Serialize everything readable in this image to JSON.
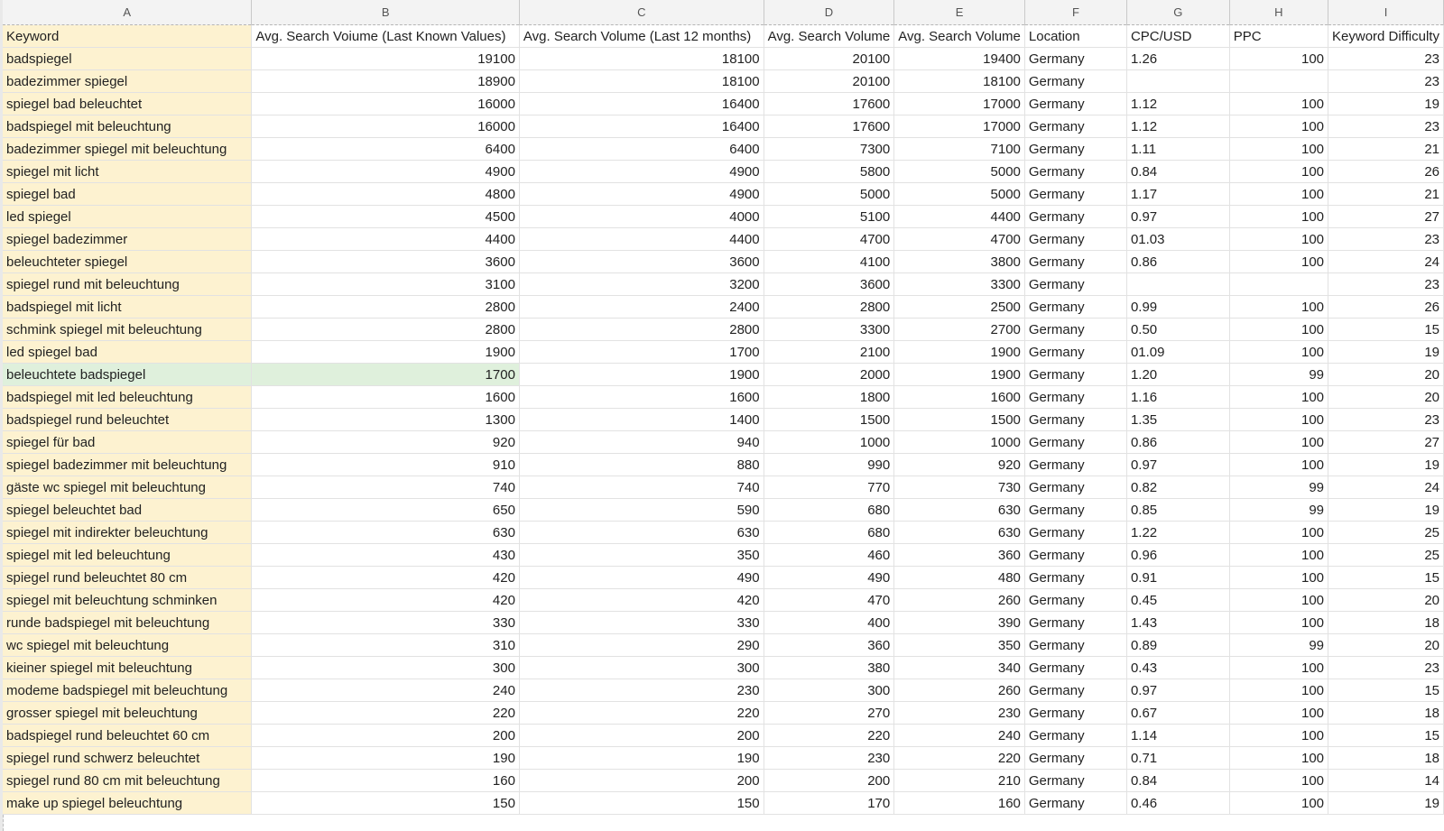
{
  "columns": [
    "A",
    "B",
    "C",
    "D",
    "E",
    "F",
    "G",
    "H",
    "I"
  ],
  "headers": [
    "Keyword",
    "Avg. Search Voiume (Last Known Values)",
    "Avg. Search Volume (Last 12 months)",
    "Avg. Search Volume",
    "Avg. Search Volume",
    "Location",
    "CPC/USD",
    "PPC",
    "Keyword Difficulty"
  ],
  "selected_row_index": 14,
  "colors": {
    "keyword_fill": "#fdf2d0",
    "selected_fill": "#dff0dc"
  },
  "rows": [
    [
      "badspiegel",
      "19100",
      "18100",
      "20100",
      "19400",
      "Germany",
      "1.26",
      "100",
      "23"
    ],
    [
      "badezimmer spiegel",
      "18900",
      "18100",
      "20100",
      "18100",
      "Germany",
      "",
      "",
      "23"
    ],
    [
      "spiegel bad beleuchtet",
      "16000",
      "16400",
      "17600",
      "17000",
      "Germany",
      "1.12",
      "100",
      "19"
    ],
    [
      "badspiegel mit beleuchtung",
      "16000",
      "16400",
      "17600",
      "17000",
      "Germany",
      "1.12",
      "100",
      "23"
    ],
    [
      "badezimmer spiegel mit beleuchtung",
      "6400",
      "6400",
      "7300",
      "7100",
      "Germany",
      "1.11",
      "100",
      "21"
    ],
    [
      "spiegel mit licht",
      "4900",
      "4900",
      "5800",
      "5000",
      "Germany",
      "0.84",
      "100",
      "26"
    ],
    [
      "spiegel bad",
      "4800",
      "4900",
      "5000",
      "5000",
      "Germany",
      "1.17",
      "100",
      "21"
    ],
    [
      "led spiegel",
      "4500",
      "4000",
      "5100",
      "4400",
      "Germany",
      "0.97",
      "100",
      "27"
    ],
    [
      "spiegel badezimmer",
      "4400",
      "4400",
      "4700",
      "4700",
      "Germany",
      "01.03",
      "100",
      "23"
    ],
    [
      "beleuchteter spiegel",
      "3600",
      "3600",
      "4100",
      "3800",
      "Germany",
      "0.86",
      "100",
      "24"
    ],
    [
      "spiegel rund mit beleuchtung",
      "3100",
      "3200",
      "3600",
      "3300",
      "Germany",
      "",
      "",
      "23"
    ],
    [
      "badspiegel mit licht",
      "2800",
      "2400",
      "2800",
      "2500",
      "Germany",
      "0.99",
      "100",
      "26"
    ],
    [
      "schmink spiegel mit beleuchtung",
      "2800",
      "2800",
      "3300",
      "2700",
      "Germany",
      "0.50",
      "100",
      "15"
    ],
    [
      "led spiegel bad",
      "1900",
      "1700",
      "2100",
      "1900",
      "Germany",
      "01.09",
      "100",
      "19"
    ],
    [
      "beleuchtete badspiegel",
      "1700",
      "1900",
      "2000",
      "1900",
      "Germany",
      "1.20",
      "99",
      "20"
    ],
    [
      "badspiegel mit led beleuchtung",
      "1600",
      "1600",
      "1800",
      "1600",
      "Germany",
      "1.16",
      "100",
      "20"
    ],
    [
      "badspiegel rund beleuchtet",
      "1300",
      "1400",
      "1500",
      "1500",
      "Germany",
      "1.35",
      "100",
      "23"
    ],
    [
      "spiegel für bad",
      "920",
      "940",
      "1000",
      "1000",
      "Germany",
      "0.86",
      "100",
      "27"
    ],
    [
      "spiegel badezimmer mit beleuchtung",
      "910",
      "880",
      "990",
      "920",
      "Germany",
      "0.97",
      "100",
      "19"
    ],
    [
      "gäste wc spiegel mit beleuchtung",
      "740",
      "740",
      "770",
      "730",
      "Germany",
      "0.82",
      "99",
      "24"
    ],
    [
      "spiegel beleuchtet bad",
      "650",
      "590",
      "680",
      "630",
      "Germany",
      "0.85",
      "99",
      "19"
    ],
    [
      "spiegel mit indirekter beleuchtung",
      "630",
      "630",
      "680",
      "630",
      "Germany",
      "1.22",
      "100",
      "25"
    ],
    [
      "spiegel mit led beleuchtung",
      "430",
      "350",
      "460",
      "360",
      "Germany",
      "0.96",
      "100",
      "25"
    ],
    [
      "spiegel rund beleuchtet 80 cm",
      "420",
      "490",
      "490",
      "480",
      "Germany",
      "0.91",
      "100",
      "15"
    ],
    [
      "spiegel mit beleuchtung schminken",
      "420",
      "420",
      "470",
      "260",
      "Germany",
      "0.45",
      "100",
      "20"
    ],
    [
      "runde badspiegel mit beleuchtung",
      "330",
      "330",
      "400",
      "390",
      "Germany",
      "1.43",
      "100",
      "18"
    ],
    [
      "wc spiegel mit beleuchtung",
      "310",
      "290",
      "360",
      "350",
      "Germany",
      "0.89",
      "99",
      "20"
    ],
    [
      "kieiner spiegel mit beleuchtung",
      "300",
      "300",
      "380",
      "340",
      "Germany",
      "0.43",
      "100",
      "23"
    ],
    [
      "modeme badspiegel mit beleuchtung",
      "240",
      "230",
      "300",
      "260",
      "Germany",
      "0.97",
      "100",
      "15"
    ],
    [
      "grosser spiegel mit beleuchtung",
      "220",
      "220",
      "270",
      "230",
      "Germany",
      "0.67",
      "100",
      "18"
    ],
    [
      "badspiegel rund beleuchtet 60 cm",
      "200",
      "200",
      "220",
      "240",
      "Germany",
      "1.14",
      "100",
      "15"
    ],
    [
      "spiegel rund schwerz beleuchtet",
      "190",
      "190",
      "230",
      "220",
      "Germany",
      "0.71",
      "100",
      "18"
    ],
    [
      "spiegel rund 80 cm mit beleuchtung",
      "160",
      "200",
      "200",
      "210",
      "Germany",
      "0.84",
      "100",
      "14"
    ],
    [
      "make up spiegel beleuchtung",
      "150",
      "150",
      "170",
      "160",
      "Germany",
      "0.46",
      "100",
      "19"
    ]
  ]
}
